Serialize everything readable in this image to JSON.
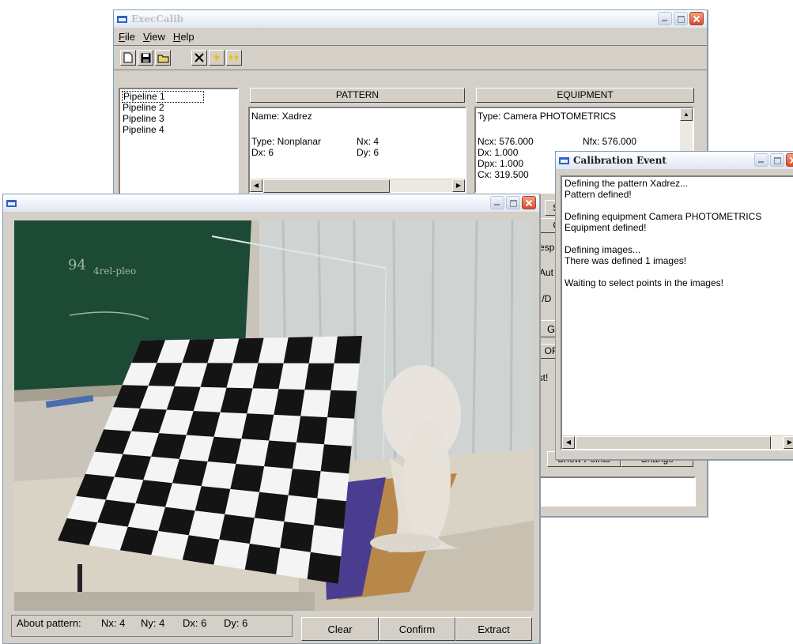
{
  "main": {
    "title": "ExecCalib",
    "menu": [
      "File",
      "View",
      "Help"
    ],
    "pipelines": [
      "Pipeline 1",
      "Pipeline 2",
      "Pipeline 3",
      "Pipeline 4"
    ],
    "pattern": {
      "header": "PATTERN",
      "name": "Name: Xadrez",
      "type": "Type: Nonplanar",
      "nx": "Nx: 4",
      "dx": "Dx: 6",
      "dy": "Dy: 6"
    },
    "equipment": {
      "header": "EQUIPMENT",
      "type": "Type: Camera PHOTOMETRICS",
      "ncx": "Ncx: 576.000",
      "nfx": "Nfx: 576.000",
      "dx": "Dx: 1.000",
      "dpx": "Dpx: 1.000",
      "cx": "Cx: 319.500"
    },
    "partial": {
      "s": "S",
      "orr": "ORF",
      "esp": "esp",
      "aut": "-Aut",
      "cd": ":/D",
      "g": "G",
      "of": "OF",
      "ist": "ist!",
      "show_points": "Show Points",
      "change": "Change"
    }
  },
  "image_window": {
    "status": {
      "about": "About pattern:",
      "nx": "Nx: 4",
      "ny": "Ny: 4",
      "dx": "Dx: 6",
      "dy": "Dy: 6"
    },
    "buttons": {
      "clear": "Clear",
      "confirm": "Confirm",
      "extract": "Extract"
    },
    "photo_colors": {
      "chalkboard": "#1d4a34",
      "wall": "#c9c4b9",
      "curtain": "#cfd4d3",
      "table": "#d9d3c6",
      "cardboard": "#b8874a",
      "mat": "#4a3d8f"
    }
  },
  "event": {
    "title": "Calibration Event",
    "log": [
      "Defining the pattern Xadrez...",
      "Pattern defined!",
      "",
      "Defining equipment Camera PHOTOMETRICS",
      "Equipment defined!",
      "",
      "Defining images...",
      "There was defined 1 images!",
      "",
      "Waiting to select points in the images!"
    ]
  }
}
